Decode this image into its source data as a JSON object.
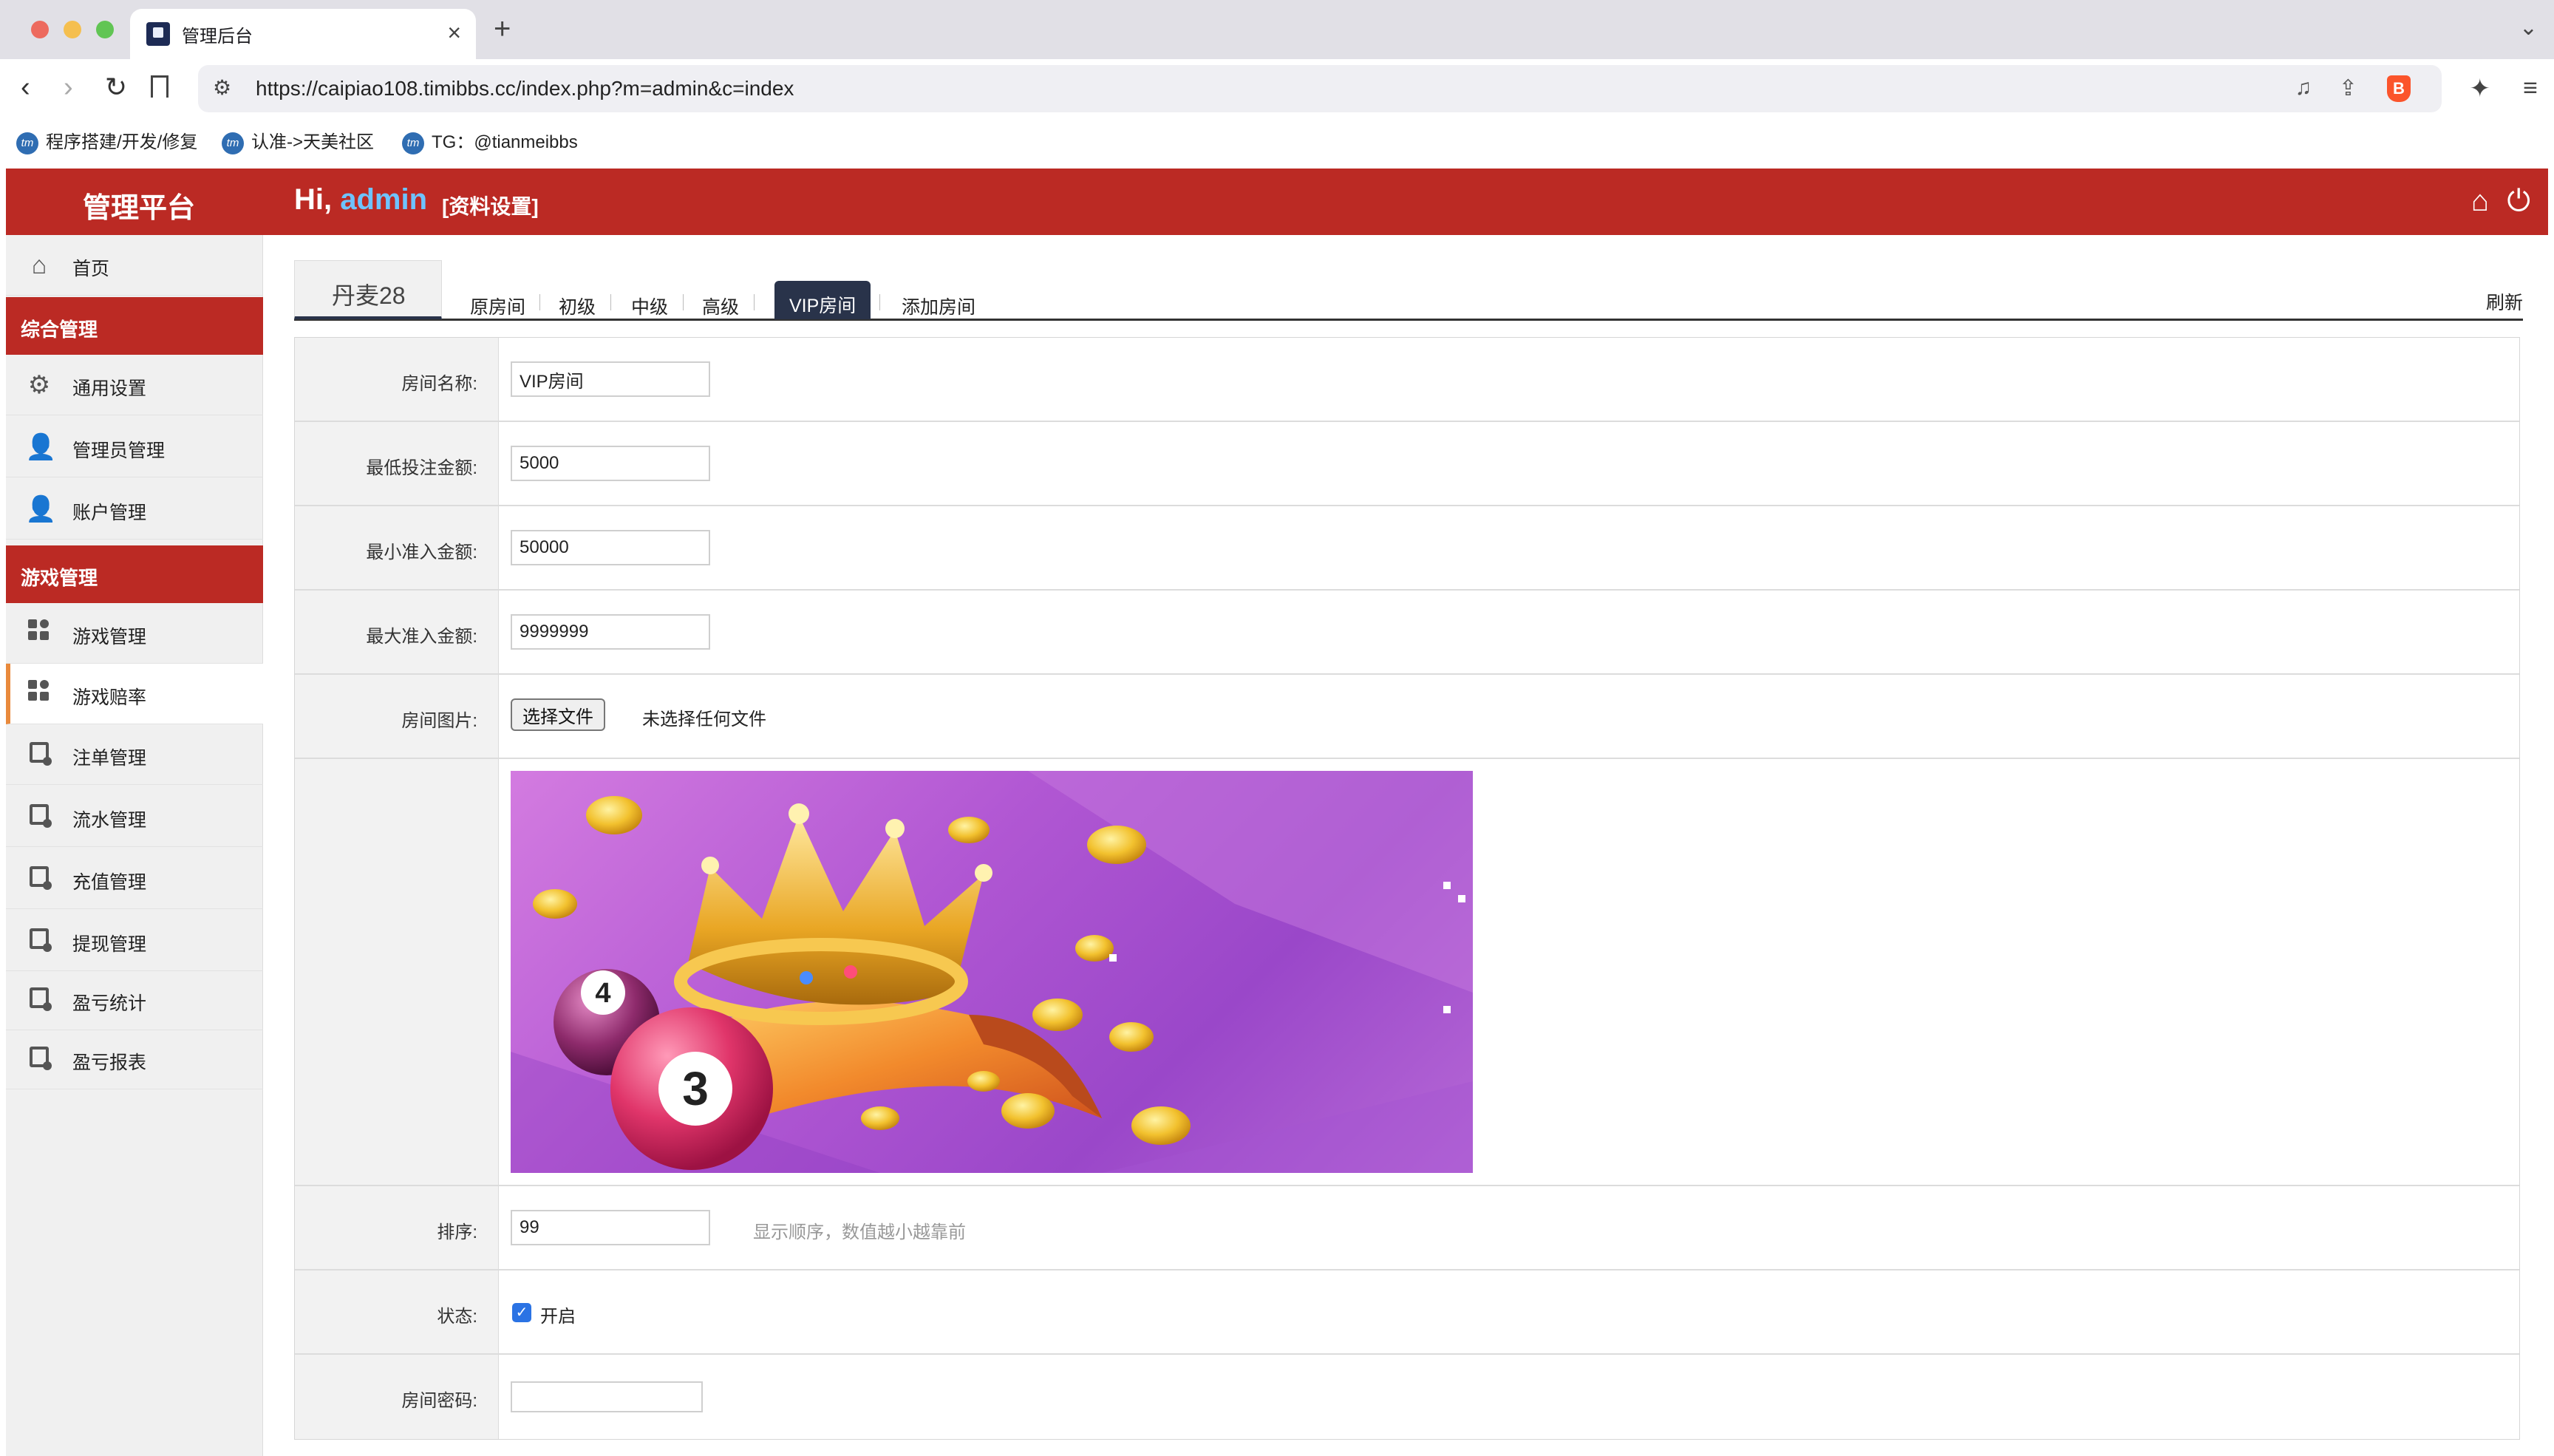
{
  "browser": {
    "tab_title": "管理后台",
    "url": "https://caipiao108.timibbs.cc/index.php?m=admin&c=index",
    "bookmarks": [
      {
        "label": "程序搭建/开发/修复"
      },
      {
        "label": "认准->天美社区"
      },
      {
        "label": "TG：@tianmeibbs"
      }
    ]
  },
  "header": {
    "app_title": "管理平台",
    "greeting": "Hi,",
    "username": "admin",
    "profile_link": "[资料设置]"
  },
  "sidebar": {
    "home": {
      "label": "首页",
      "icon": "home-icon"
    },
    "section1": "综合管理",
    "section1_items": [
      {
        "label": "通用设置",
        "icon": "gear-icon"
      },
      {
        "label": "管理员管理",
        "icon": "admin-user-icon"
      },
      {
        "label": "账户管理",
        "icon": "user-icon"
      }
    ],
    "section2": "游戏管理",
    "section2_items": [
      {
        "label": "游戏管理",
        "icon": "grid-icon"
      },
      {
        "label": "游戏赔率",
        "icon": "grid-icon",
        "active": true
      },
      {
        "label": "注单管理",
        "icon": "form-icon"
      },
      {
        "label": "流水管理",
        "icon": "form-icon"
      },
      {
        "label": "充值管理",
        "icon": "form-icon"
      },
      {
        "label": "提现管理",
        "icon": "form-icon"
      },
      {
        "label": "盈亏统计",
        "icon": "form-icon"
      },
      {
        "label": "盈亏报表",
        "icon": "form-icon"
      }
    ]
  },
  "main": {
    "game_tab": "丹麦28",
    "room_tabs": [
      "原房间",
      "初级",
      "中级",
      "高级",
      "VIP房间",
      "添加房间"
    ],
    "active_room_tab": "VIP房间",
    "refresh": "刷新",
    "form": {
      "room_name": {
        "label": "房间名称:",
        "value": "VIP房间"
      },
      "min_bet": {
        "label": "最低投注金额:",
        "value": "5000"
      },
      "min_entry": {
        "label": "最小准入金额:",
        "value": "50000"
      },
      "max_entry": {
        "label": "最大准入金额:",
        "value": "9999999"
      },
      "room_image": {
        "label": "房间图片:",
        "button": "选择文件",
        "status": "未选择任何文件"
      },
      "image_preview": {
        "ball1": "4",
        "ball2": "3"
      },
      "sort": {
        "label": "排序:",
        "value": "99",
        "hint": "显示顺序，数值越小越靠前"
      },
      "status": {
        "label": "状态:",
        "checked": true,
        "option": "开启"
      },
      "room_password": {
        "label": "房间密码:",
        "value": ""
      }
    }
  },
  "colors": {
    "brand_red": "#bb2a24",
    "active_tab": "#29334a",
    "username": "#6ec3ff",
    "active_sidebar_marker": "#e98a3c"
  }
}
